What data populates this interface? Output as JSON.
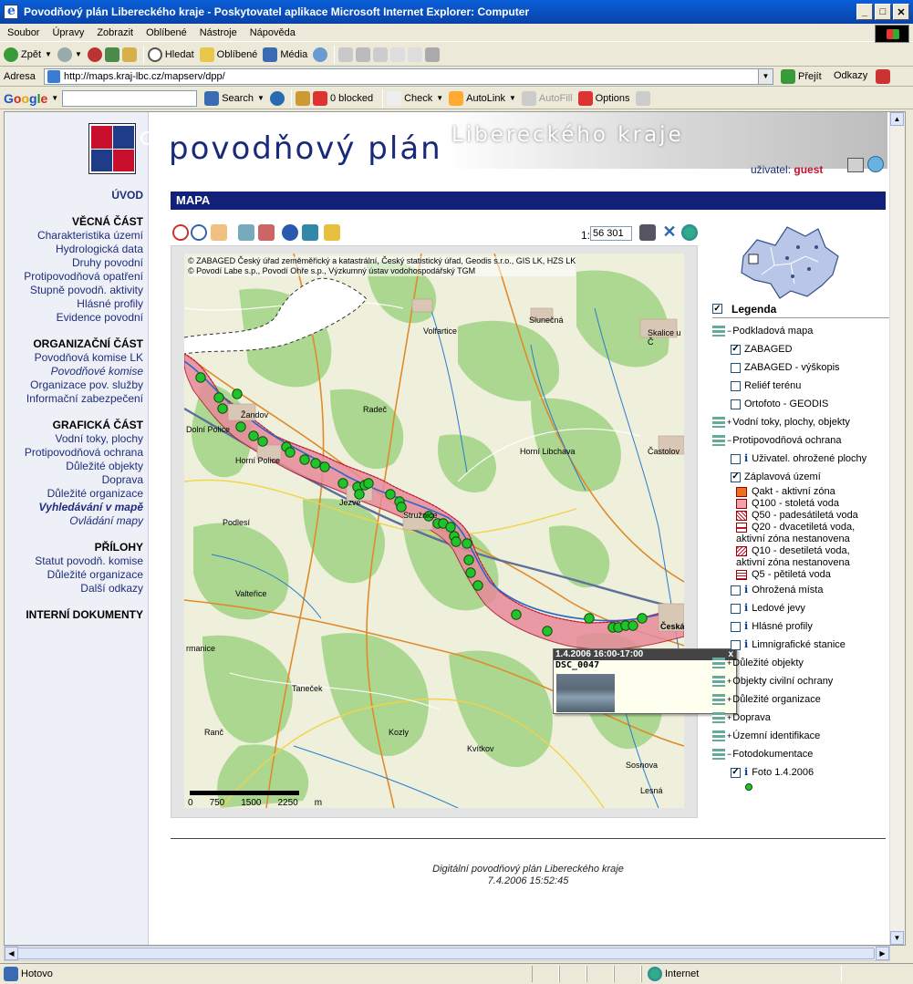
{
  "window": {
    "title": "Povodňový plán Libereckého kraje - Poskytovatel aplikace Microsoft Internet Explorer: Computer"
  },
  "menubar": [
    "Soubor",
    "Úpravy",
    "Zobrazit",
    "Oblíbené",
    "Nástroje",
    "Nápověda"
  ],
  "toolbar": {
    "back": "Zpět",
    "search": "Hledat",
    "favorites": "Oblíbené",
    "media": "Média"
  },
  "address": {
    "label": "Adresa",
    "url": "http://maps.kraj-lbc.cz/mapserv/dpp/",
    "go": "Přejít",
    "links": "Odkazy"
  },
  "google_bar": {
    "search_btn": "Search",
    "blocked": "0 blocked",
    "check": "Check",
    "autolink": "AutoLink",
    "autofill": "AutoFill",
    "options": "Options"
  },
  "header": {
    "title1": "povodňový plán",
    "title2": "Libereckého kraje",
    "user_label": "uživatel:",
    "user_name": "guest"
  },
  "nav": {
    "intro": "ÚVOD",
    "groups": [
      {
        "head": "VĚCNÁ ČÁST",
        "items": [
          "Charakteristika území",
          "Hydrologická data",
          "Druhy povodní",
          "Protipovodňová opatření",
          "Stupně povodň. aktivity",
          "Hlásné profily",
          "Evidence povodní"
        ]
      },
      {
        "head": "ORGANIZAČNÍ ČÁST",
        "items": [
          "Povodňová komise LK",
          "Povodňové komise",
          "Organizace pov. služby",
          "Informační zabezpečení"
        ]
      },
      {
        "head": "GRAFICKÁ ČÁST",
        "items": [
          "Vodní toky, plochy",
          "Protipovodňová ochrana",
          "Důležité objekty",
          "Doprava",
          "Důležité organizace",
          "Vyhledávání v mapě",
          "Ovládání mapy"
        ]
      },
      {
        "head": "PŘÍLOHY",
        "items": [
          "Statut povodň. komise",
          "Důležité organizace",
          "Další odkazy"
        ]
      },
      {
        "head": "INTERNÍ DOKUMENTY",
        "items": []
      }
    ]
  },
  "section_title": "MAPA",
  "map": {
    "scale_prefix": "1:",
    "scale_value": "56 301",
    "copyright1": "© ZABAGED Český úřad zeměměřický a katastrální, Český statistický úřad,  Geodis s.r.o., GIS LK, HZS LK",
    "copyright2": "© Povodí Labe s.p., Povodí Ohře s.p., Výzkumný ústav vodohospodářský TGM",
    "towns": [
      "Volfartice",
      "Slunečná",
      "Skalice u Č",
      "Žandov",
      "Radeč",
      "Dolní Police",
      "Horní Police",
      "Horní Libchava",
      "Častolov",
      "Jezve",
      "Stružnice",
      "Podlesí",
      "Valteřice",
      "Česká",
      "rmanice",
      "Taneček",
      "Ranč",
      "Kozly",
      "Kvítkov",
      "Sosnova",
      "Lesná"
    ],
    "scalebar_labels": [
      "0",
      "750",
      "1500",
      "2250",
      "m"
    ],
    "popup": {
      "title": "1.4.2006 16:00-17:00",
      "file": "DSC_0047",
      "close": "x"
    }
  },
  "legend": {
    "title": "Legenda",
    "rows": [
      {
        "type": "group",
        "label": "Podkladová mapa"
      },
      {
        "type": "check",
        "checked": true,
        "label": "ZABAGED"
      },
      {
        "type": "check",
        "checked": false,
        "label": "ZABAGED - výškopis"
      },
      {
        "type": "check",
        "checked": false,
        "label": "Reliéf terénu"
      },
      {
        "type": "check",
        "checked": false,
        "label": "Ortofoto - GEODIS"
      },
      {
        "type": "group",
        "label": "Vodní toky, plochy, objekty"
      },
      {
        "type": "group",
        "label": "Protipovodňová ochrana"
      },
      {
        "type": "check-i",
        "checked": false,
        "label": "Uživatel. ohrožené plochy"
      },
      {
        "type": "check",
        "checked": true,
        "label": "Záplavová území"
      },
      {
        "type": "swatch",
        "color": "#f07020",
        "label": "Qakt - aktivní zóna"
      },
      {
        "type": "swatch",
        "color": "#f4a0a8",
        "label": "Q100 - stoletá voda"
      },
      {
        "type": "swatch",
        "color": "hatch-red",
        "label": "Q50 - padesátiletá voda"
      },
      {
        "type": "swatch",
        "color": "hatch-line",
        "label": "Q20 - dvacetiletá voda,"
      },
      {
        "type": "text",
        "label": "aktivní zóna nestanovena"
      },
      {
        "type": "swatch",
        "color": "hatch-diag",
        "label": "Q10 - desetiletá voda,"
      },
      {
        "type": "text",
        "label": "aktivní zóna nestanovena"
      },
      {
        "type": "swatch",
        "color": "hatch-grid",
        "label": "Q5 - pětiletá voda"
      },
      {
        "type": "check-i",
        "checked": false,
        "label": "Ohrožená místa"
      },
      {
        "type": "check-i",
        "checked": false,
        "label": "Ledové jevy"
      },
      {
        "type": "check-i",
        "checked": false,
        "label": "Hlásné profily"
      },
      {
        "type": "check-i",
        "checked": false,
        "label": "Limnigrafické stanice"
      },
      {
        "type": "group",
        "label": "Důležité objekty"
      },
      {
        "type": "group",
        "label": "Objekty civilní ochrany"
      },
      {
        "type": "group",
        "label": "Důležité organizace"
      },
      {
        "type": "group",
        "label": "Doprava"
      },
      {
        "type": "group",
        "label": "Územní identifikace"
      },
      {
        "type": "group",
        "label": "Fotodokumentace"
      },
      {
        "type": "check-i",
        "checked": true,
        "label": "Foto 1.4.2006"
      }
    ]
  },
  "footer": {
    "line1": "Digitální povodňový plán Libereckého kraje",
    "line2": "7.4.2006 15:52:45"
  },
  "status": {
    "left": "Hotovo",
    "zone": "Internet"
  },
  "colors": {
    "navy": "#12207a",
    "flood_red": "#c8102e",
    "photo_point": "#22c32a"
  }
}
